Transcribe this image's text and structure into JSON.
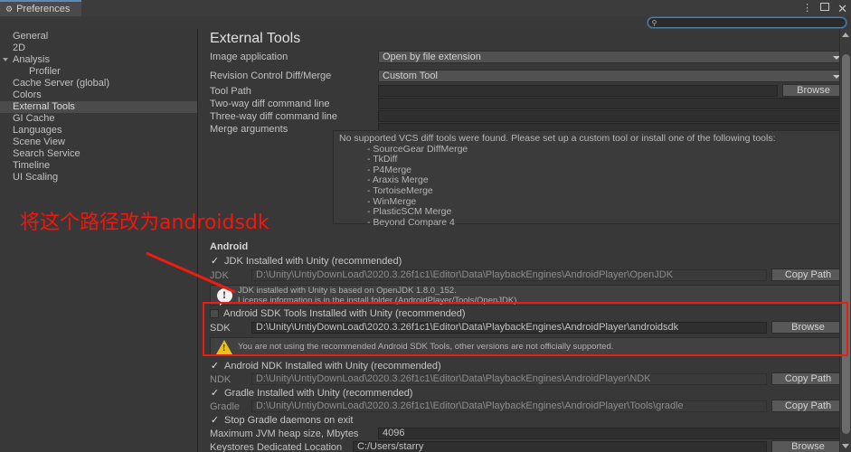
{
  "window": {
    "tab_label": "Preferences",
    "tab_icon": "gear-icon",
    "menu_icon": "more-vertical-icon",
    "maximize_icon": "maximize-icon",
    "close_icon": "close-icon"
  },
  "search": {
    "value": "",
    "placeholder": "",
    "icon": "search-icon"
  },
  "sidebar": {
    "items": [
      {
        "label": "General",
        "indent": false,
        "selected": false,
        "arrow": false
      },
      {
        "label": "2D",
        "indent": false,
        "selected": false,
        "arrow": false
      },
      {
        "label": "Analysis",
        "indent": false,
        "selected": false,
        "arrow": true
      },
      {
        "label": "Profiler",
        "indent": true,
        "selected": false,
        "arrow": false
      },
      {
        "label": "Cache Server (global)",
        "indent": false,
        "selected": false,
        "arrow": false
      },
      {
        "label": "Colors",
        "indent": false,
        "selected": false,
        "arrow": false
      },
      {
        "label": "External Tools",
        "indent": false,
        "selected": true,
        "arrow": false
      },
      {
        "label": "GI Cache",
        "indent": false,
        "selected": false,
        "arrow": false
      },
      {
        "label": "Languages",
        "indent": false,
        "selected": false,
        "arrow": false
      },
      {
        "label": "Scene View",
        "indent": false,
        "selected": false,
        "arrow": false
      },
      {
        "label": "Search Service",
        "indent": false,
        "selected": false,
        "arrow": false
      },
      {
        "label": "Timeline",
        "indent": false,
        "selected": false,
        "arrow": false
      },
      {
        "label": "UI Scaling",
        "indent": false,
        "selected": false,
        "arrow": false
      }
    ]
  },
  "main": {
    "title": "External Tools",
    "image_application": {
      "label": "Image application",
      "value": "Open by file extension"
    },
    "revision_control": {
      "label": "Revision Control Diff/Merge",
      "value": "Custom Tool"
    },
    "tool_path": {
      "label": "Tool Path",
      "value": "",
      "browse_label": "Browse"
    },
    "two_way": {
      "label": "Two-way diff command line",
      "value": ""
    },
    "three_way": {
      "label": "Three-way diff command line",
      "value": ""
    },
    "merge_args": {
      "label": "Merge arguments",
      "value": ""
    },
    "vcs_notice": {
      "heading": "No supported VCS diff tools were found. Please set up a custom tool or install one of the following tools:",
      "tools": [
        "- SourceGear DiffMerge",
        "- TkDiff",
        "- P4Merge",
        "- Araxis Merge",
        "- TortoiseMerge",
        "- WinMerge",
        "- PlasticSCM Merge",
        "- Beyond Compare 4"
      ]
    },
    "android": {
      "section_label": "Android",
      "jdk": {
        "checkbox_label": "JDK Installed with Unity (recommended)",
        "checked": true,
        "field_label": "JDK",
        "path": "D:\\Unity\\UntiyDownLoad\\2020.3.26f1c1\\Editor\\Data\\PlaybackEngines\\AndroidPlayer\\OpenJDK",
        "button_label": "Copy Path",
        "info_icon": "info-bubble-icon",
        "info_line1": "JDK installed with Unity is based on OpenJDK 1.8.0_152.",
        "info_line2": "License information is in the install folder (AndroidPlayer/Tools/OpenJDK)."
      },
      "sdk": {
        "checkbox_label": "Android SDK Tools Installed with Unity (recommended)",
        "checked": false,
        "field_label": "SDK",
        "path": "D:\\Unity\\UntiyDownLoad\\2020.3.26f1c1\\Editor\\Data\\PlaybackEngines\\AndroidPlayer\\androidsdk",
        "button_label": "Browse",
        "warning_icon": "warning-triangle-icon",
        "warning_text": "You are not using the recommended Android SDK Tools, other versions are not officially supported."
      },
      "ndk": {
        "checkbox_label": "Android NDK Installed with Unity (recommended)",
        "checked": true,
        "field_label": "NDK",
        "path": "D:\\Unity\\UntiyDownLoad\\2020.3.26f1c1\\Editor\\Data\\PlaybackEngines\\AndroidPlayer\\NDK",
        "button_label": "Copy Path"
      },
      "gradle": {
        "checkbox_label": "Gradle Installed with Unity (recommended)",
        "checked": true,
        "field_label": "Gradle",
        "path": "D:\\Unity\\UntiyDownLoad\\2020.3.26f1c1\\Editor\\Data\\PlaybackEngines\\AndroidPlayer\\Tools\\gradle",
        "button_label": "Copy Path"
      },
      "stop_gradle": {
        "checkbox_label": "Stop Gradle daemons on exit",
        "checked": true
      },
      "jvm_heap": {
        "label": "Maximum JVM heap size, Mbytes",
        "value": "4096"
      },
      "keystores": {
        "label": "Keystores Dedicated Location",
        "value": "C:/Users/starry",
        "button_label": "Browse"
      }
    }
  },
  "annotation": {
    "text": "将这个路径改为androidsdk",
    "color": "#f2160f"
  }
}
